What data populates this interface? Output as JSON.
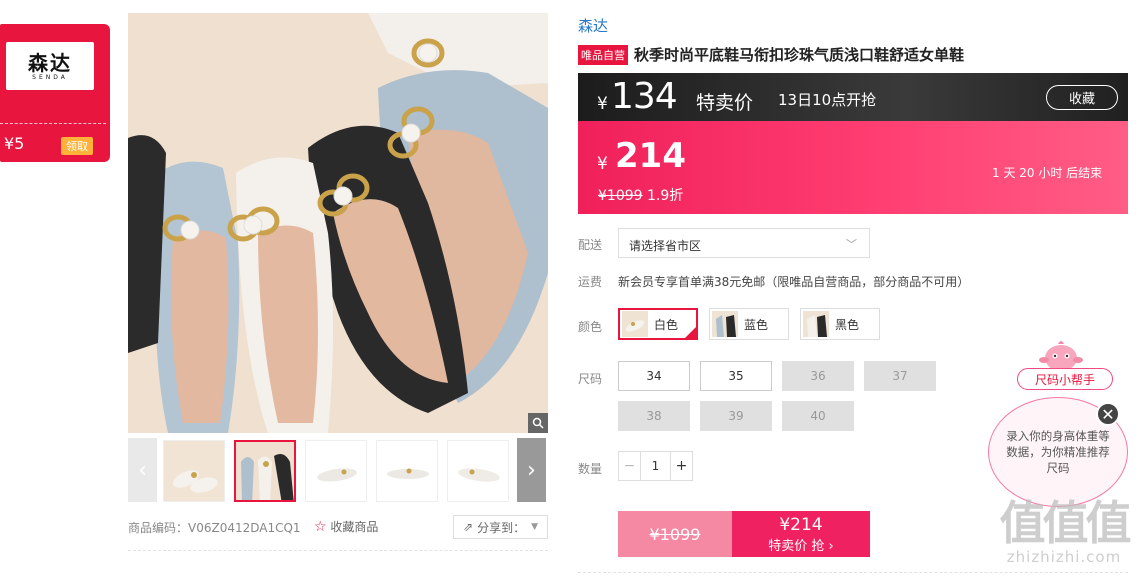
{
  "coupon": {
    "brand_cn": "森达",
    "brand_en": "SENDA",
    "amount": "¥5",
    "claim_label": "领取"
  },
  "gallery": {
    "product_code": "商品编码：V06Z0412DA1CQ1",
    "favorite_label": "收藏商品",
    "share_label": "分享到：",
    "selected_thumb": 2
  },
  "product": {
    "brand": "森达",
    "tag": "唯品自营",
    "title": "秋季时尚平底鞋马衔扣珍珠气质浅口鞋舒适女单鞋"
  },
  "banner": {
    "currency": "¥",
    "special_price": "134",
    "special_label": "特卖价",
    "start_time": "13日10点开抢",
    "collect_label": "收藏"
  },
  "price": {
    "currency": "¥",
    "current": "214",
    "original": "¥1099",
    "discount": "1.9折",
    "ends_in": "1 天 20 小时 后结束"
  },
  "shipping": {
    "label": "配送",
    "placeholder": "请选择省市区"
  },
  "freight": {
    "label": "运费",
    "text": "新会员专享首单满38元免邮（限唯品自营商品，部分商品不可用）"
  },
  "colors": {
    "label": "颜色",
    "options": [
      "白色",
      "蓝色",
      "黑色"
    ],
    "selected": 0
  },
  "sizes": {
    "label": "尺码",
    "options": [
      {
        "value": "34",
        "available": true
      },
      {
        "value": "35",
        "available": true
      },
      {
        "value": "36",
        "available": false
      },
      {
        "value": "37",
        "available": false
      },
      {
        "value": "38",
        "available": false
      },
      {
        "value": "39",
        "available": false
      },
      {
        "value": "40",
        "available": false
      }
    ]
  },
  "quantity": {
    "label": "数量",
    "value": "1",
    "minus": "−",
    "plus": "+"
  },
  "buy": {
    "original": "¥1099",
    "price": "¥214",
    "label": "特卖价 抢 ›"
  },
  "helper": {
    "label": "尺码小帮手",
    "text": "录入你的身高体重等数据，为你精准推荐尺码",
    "close": "✕"
  },
  "watermark": {
    "glyphs": "值值值",
    "url": "zhizhizhi.com"
  },
  "colors_theme": {
    "accent": "#e8163f",
    "pink": "#ff3e72",
    "link": "#2a78c8"
  }
}
